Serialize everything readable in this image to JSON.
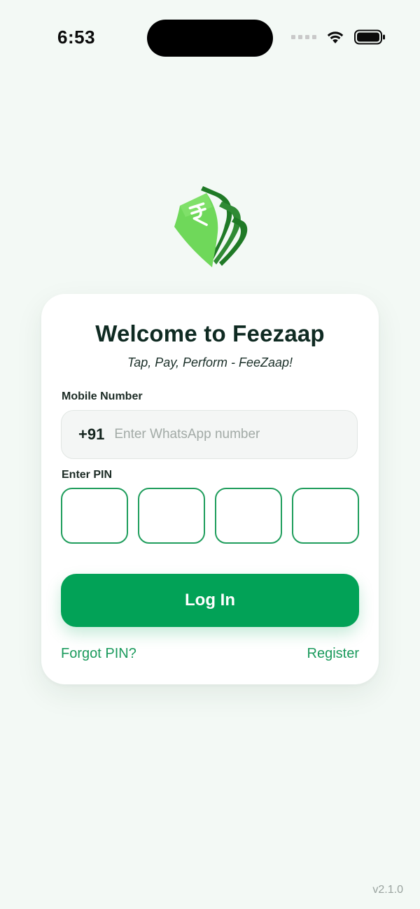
{
  "status_bar": {
    "time": "6:53"
  },
  "logo": {
    "icon": "rupee-notes-icon",
    "symbol": "₹",
    "colors": {
      "light_green": "#6fd85a",
      "dark_green": "#1f7a26"
    }
  },
  "login_card": {
    "title": "Welcome to Feezaap",
    "subtitle": "Tap, Pay, Perform - FeeZaap!",
    "mobile": {
      "label": "Mobile Number",
      "country_code": "+91",
      "value": "",
      "placeholder": "Enter WhatsApp number"
    },
    "pin": {
      "label": "Enter PIN",
      "digits": [
        "",
        "",
        "",
        ""
      ]
    },
    "login_button": "Log In",
    "forgot_link": "Forgot PIN?",
    "register_link": "Register"
  },
  "footer": {
    "version": "v2.1.0"
  },
  "colors": {
    "background": "#f3f9f5",
    "accent": "#02a257",
    "link": "#1a9a5c",
    "pin_border": "#1f9d5c"
  }
}
